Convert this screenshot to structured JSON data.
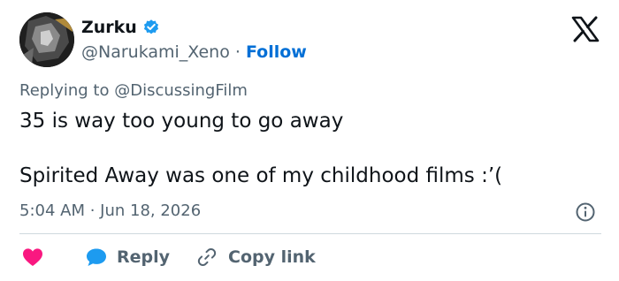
{
  "author": {
    "name": "Zurku",
    "handle": "@Narukami_Xeno",
    "separator": "·",
    "follow_label": "Follow"
  },
  "reply_context": {
    "prefix": "Replying to",
    "mention": "@DiscussingFilm"
  },
  "tweet": {
    "line1": "35 is way too young to go away",
    "line2": "Spirited Away was one of my childhood films :’("
  },
  "timestamp": "5:04 AM · Jun 18, 2026",
  "actions": {
    "reply_label": "Reply",
    "copy_label": "Copy link"
  },
  "colors": {
    "accent": "#006fd6",
    "heart": "#f91880",
    "reply_bubble": "#1d9bf0",
    "muted_text": "#536471",
    "main_text": "#0f1419"
  },
  "icons": [
    "verified-badge-icon",
    "x-logo-icon",
    "info-icon",
    "heart-icon",
    "reply-bubble-icon",
    "link-icon"
  ]
}
